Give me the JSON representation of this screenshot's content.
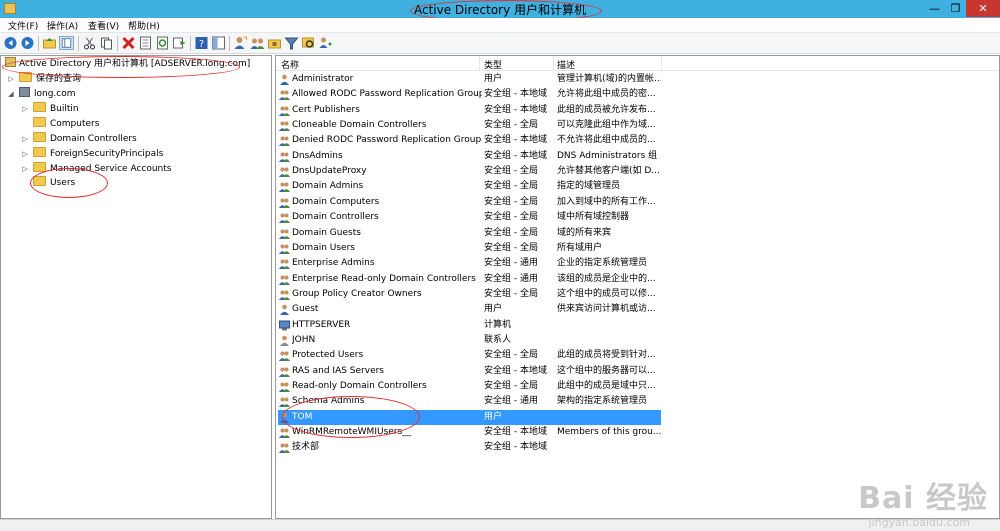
{
  "window": {
    "title": "Active Directory 用户和计算机"
  },
  "menu": [
    "文件(F)",
    "操作(A)",
    "查看(V)",
    "帮助(H)"
  ],
  "toolbar_icons": [
    "back-arrow-icon",
    "forward-arrow-icon",
    "up-folder-icon",
    "show-tree-icon",
    "cut-icon",
    "copy-icon",
    "delete-icon",
    "properties-icon",
    "refresh-icon",
    "export-icon",
    "help-icon",
    "help-panel-icon",
    "add-user-icon",
    "add-group-icon",
    "add-ou-icon",
    "filter-icon",
    "find-icon",
    "add-to-group-icon"
  ],
  "tree": {
    "root": "Active Directory 用户和计算机 [ADSERVER.long.com]",
    "saved_queries": "保存的查询",
    "domain": "long.com",
    "children": [
      "Builtin",
      "Computers",
      "Domain Controllers",
      "ForeignSecurityPrincipals",
      "Managed Service Accounts",
      "Users"
    ]
  },
  "list": {
    "columns": [
      "名称",
      "类型",
      "描述"
    ],
    "rows": [
      {
        "name": "Administrator",
        "type": "用户",
        "desc": "管理计算机(域)的内置帐..."
      },
      {
        "name": "Allowed RODC Password Replication Group",
        "type": "安全组 - 本地域",
        "desc": "允许将此组中成员的密..."
      },
      {
        "name": "Cert Publishers",
        "type": "安全组 - 本地域",
        "desc": "此组的成员被允许发布..."
      },
      {
        "name": "Cloneable Domain Controllers",
        "type": "安全组 - 全局",
        "desc": "可以克隆此组中作为域..."
      },
      {
        "name": "Denied RODC Password Replication Group",
        "type": "安全组 - 本地域",
        "desc": "不允许将此组中成员的..."
      },
      {
        "name": "DnsAdmins",
        "type": "安全组 - 本地域",
        "desc": "DNS Administrators 组"
      },
      {
        "name": "DnsUpdateProxy",
        "type": "安全组 - 全局",
        "desc": "允许替其他客户端(如 D..."
      },
      {
        "name": "Domain Admins",
        "type": "安全组 - 全局",
        "desc": "指定的域管理员"
      },
      {
        "name": "Domain Computers",
        "type": "安全组 - 全局",
        "desc": "加入到域中的所有工作..."
      },
      {
        "name": "Domain Controllers",
        "type": "安全组 - 全局",
        "desc": "域中所有域控制器"
      },
      {
        "name": "Domain Guests",
        "type": "安全组 - 全局",
        "desc": "域的所有来宾"
      },
      {
        "name": "Domain Users",
        "type": "安全组 - 全局",
        "desc": "所有域用户"
      },
      {
        "name": "Enterprise Admins",
        "type": "安全组 - 通用",
        "desc": "企业的指定系统管理员"
      },
      {
        "name": "Enterprise Read-only Domain Controllers",
        "type": "安全组 - 通用",
        "desc": "该组的成员是企业中的..."
      },
      {
        "name": "Group Policy Creator Owners",
        "type": "安全组 - 全局",
        "desc": "这个组中的成员可以修..."
      },
      {
        "name": "Guest",
        "type": "用户",
        "desc": "供来宾访问计算机或访..."
      },
      {
        "name": "HTTPSERVER",
        "type": "计算机",
        "desc": ""
      },
      {
        "name": "JOHN",
        "type": "联系人",
        "desc": ""
      },
      {
        "name": "Protected Users",
        "type": "安全组 - 全局",
        "desc": "此组的成员将受到针对..."
      },
      {
        "name": "RAS and IAS Servers",
        "type": "安全组 - 本地域",
        "desc": "这个组中的服务器可以..."
      },
      {
        "name": "Read-only Domain Controllers",
        "type": "安全组 - 全局",
        "desc": "此组中的成员是域中只..."
      },
      {
        "name": "Schema Admins",
        "type": "安全组 - 通用",
        "desc": "架构的指定系统管理员"
      },
      {
        "name": "TOM",
        "type": "用户",
        "desc": ""
      },
      {
        "name": "WinRMRemoteWMIUsers__",
        "type": "安全组 - 本地域",
        "desc": "Members of this grou..."
      },
      {
        "name": "技术部",
        "type": "安全组 - 本地域",
        "desc": ""
      }
    ],
    "selected": "TOM"
  },
  "watermark": {
    "main": "Bai 经验",
    "sub": "jingyan.baidu.com"
  },
  "colors": {
    "titlebar": "#40b0e0",
    "selection": "#3399ff",
    "annotation": "#e03030"
  }
}
